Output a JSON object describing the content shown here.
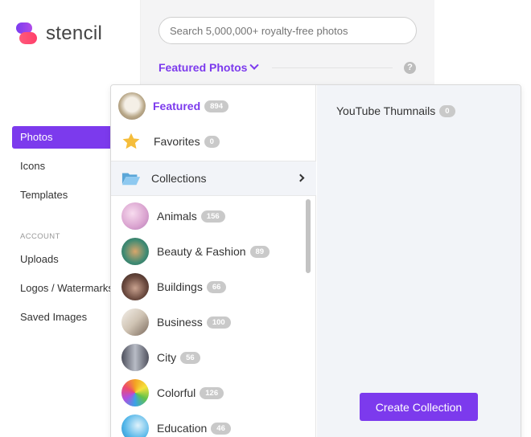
{
  "brand": {
    "name": "stencil"
  },
  "sidebar": {
    "items": [
      {
        "label": "Photos",
        "active": true
      },
      {
        "label": "Icons"
      },
      {
        "label": "Templates"
      }
    ],
    "account_heading": "ACCOUNT",
    "account_items": [
      {
        "label": "Uploads"
      },
      {
        "label": "Logos / Watermarks"
      },
      {
        "label": "Saved Images"
      }
    ]
  },
  "search": {
    "placeholder": "Search 5,000,000+ royalty-free photos"
  },
  "header": {
    "dropdown_label": "Featured Photos",
    "help": "?"
  },
  "dropdown": {
    "featured": {
      "label": "Featured",
      "count": "894"
    },
    "favorites": {
      "label": "Favorites",
      "count": "0"
    },
    "collections": {
      "label": "Collections"
    },
    "categories": [
      {
        "label": "Animals",
        "count": "156",
        "color": "#e9b9d9"
      },
      {
        "label": "Beauty & Fashion",
        "count": "89",
        "color": "#6aa88a"
      },
      {
        "label": "Buildings",
        "count": "66",
        "color": "#6b4a3f"
      },
      {
        "label": "Business",
        "count": "100",
        "color": "#d9d2c9"
      },
      {
        "label": "City",
        "count": "56",
        "color": "#7a7a85"
      },
      {
        "label": "Colorful",
        "count": "126",
        "color": "#f3a323"
      },
      {
        "label": "Education",
        "count": "46",
        "color": "#4fb4e8"
      }
    ],
    "collection_list": [
      {
        "label": "YouTube Thumnails",
        "count": "0"
      }
    ],
    "create_button": "Create Collection"
  },
  "colors": {
    "accent": "#7c3aed",
    "badge": "#c9c9c9"
  }
}
